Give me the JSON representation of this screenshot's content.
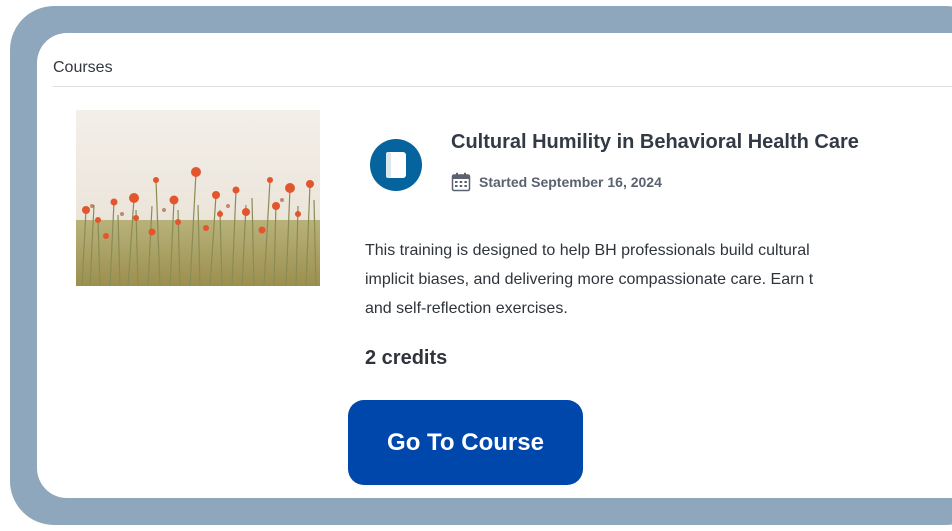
{
  "section": {
    "title": "Courses"
  },
  "course": {
    "title": "Cultural Humility in Behavioral Health Care",
    "started": "Started September 16, 2024",
    "description_lines": [
      "This training is designed to help BH professionals build cultural",
      "implicit biases, and delivering more compassionate care. Earn t",
      "and self-reflection exercises."
    ],
    "credits": "2 credits",
    "button_label": "Go To Course",
    "icon": "book-icon",
    "date_icon": "calendar-icon"
  },
  "colors": {
    "frame": "#8fa7bd",
    "accent_button": "#0047ab",
    "course_icon": "#05639e",
    "title_text": "#323a46"
  }
}
